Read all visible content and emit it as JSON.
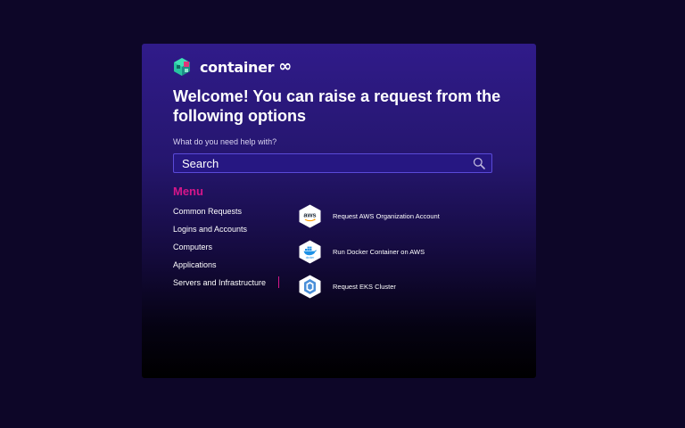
{
  "brand": {
    "name": "container",
    "symbol": "∞",
    "colors": {
      "accent": "#d6168a",
      "mark_teal": "#27c4a0",
      "mark_pink": "#e0367a"
    }
  },
  "headline": "Welcome! You can raise a request from the following options",
  "search": {
    "label": "What do you need help with?",
    "placeholder": "Search"
  },
  "menu": {
    "title": "Menu",
    "items": [
      {
        "label": "Common Requests"
      },
      {
        "label": "Logins and Accounts"
      },
      {
        "label": "Computers"
      },
      {
        "label": "Applications"
      },
      {
        "label": "Servers and Infrastructure",
        "selected": true
      }
    ]
  },
  "options": [
    {
      "label": "Request AWS Organization Account",
      "icon": "aws-icon",
      "icon_text": "aws"
    },
    {
      "label": "Run Docker Container on AWS",
      "icon": "docker-icon",
      "icon_text": "docker"
    },
    {
      "label": "Request EKS Cluster",
      "icon": "eks-icon"
    }
  ]
}
